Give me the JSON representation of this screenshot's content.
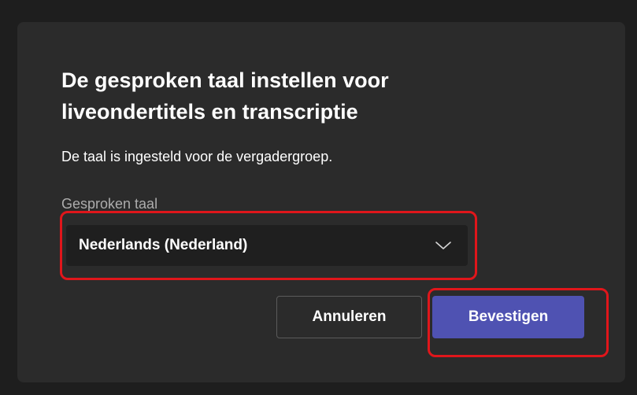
{
  "dialog": {
    "title": "De gesproken taal instellen voor liveondertitels en transcriptie",
    "subtitle": "De taal is ingesteld voor de vergadergroep.",
    "field_label": "Gesproken taal",
    "selected_language": "Nederlands (Nederland)",
    "cancel_label": "Annuleren",
    "confirm_label": "Bevestigen"
  },
  "colors": {
    "dialog_bg": "#2b2b2b",
    "select_bg": "#1f1f1f",
    "primary_button": "#4f52b2",
    "annotation_outline": "#e0161b"
  },
  "icons": {
    "dropdown": "chevron-down-icon"
  }
}
